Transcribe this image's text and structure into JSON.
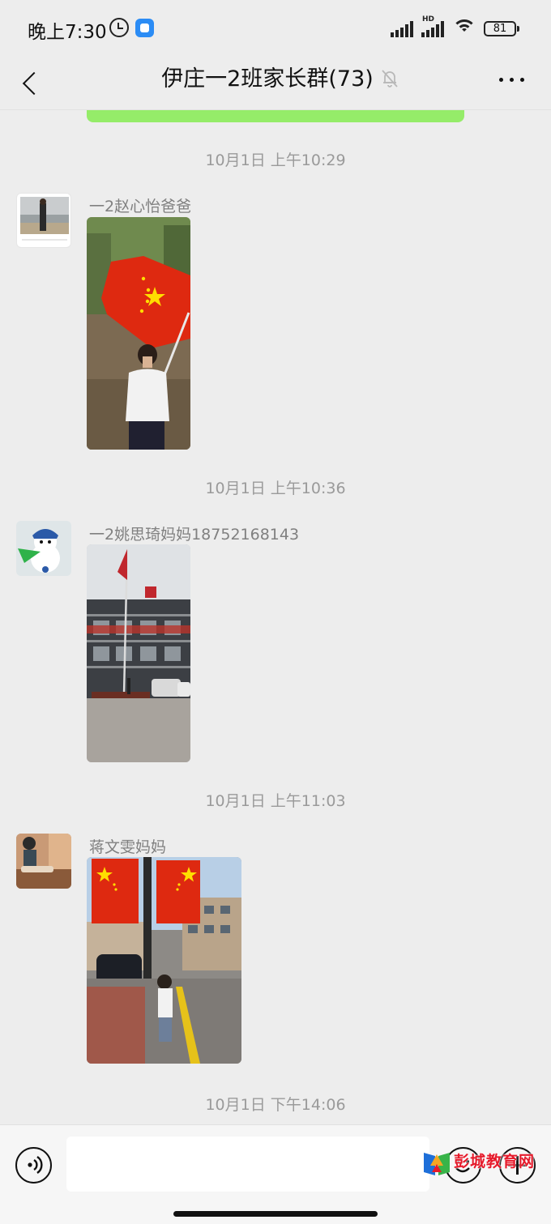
{
  "status_bar": {
    "time": "晚上7:30",
    "network_label": "HD",
    "battery": "81"
  },
  "header": {
    "title": "伊庄一2班家长群(73)"
  },
  "messages": [
    {
      "timestamp": "10月1日  上午10:29",
      "sender": "一2赵心怡爸爸"
    },
    {
      "timestamp": "10月1日  上午10:36",
      "sender": "一2姚思琦妈妈18752168143"
    },
    {
      "timestamp": "10月1日  上午11:03",
      "sender": "蒋文雯妈妈"
    }
  ],
  "last_timestamp": "10月1日  下午14:06",
  "watermark": {
    "text": "彭城教育网"
  },
  "colors": {
    "background": "#ededed",
    "bubble_green": "#95ec69",
    "flag_red": "#de2910",
    "star_yellow": "#ffde00"
  }
}
